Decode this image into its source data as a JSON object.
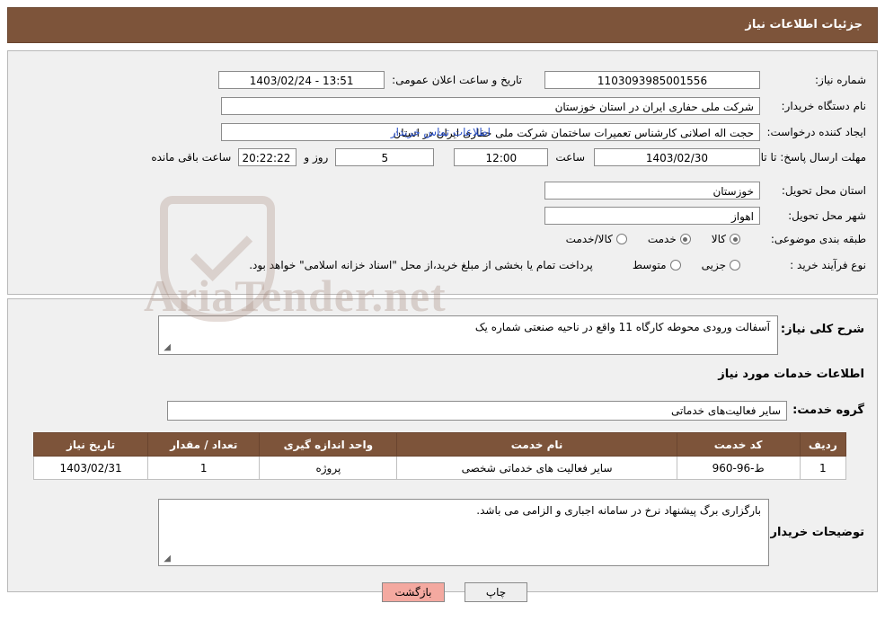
{
  "header": {
    "title": "جزئیات اطلاعات نیاز"
  },
  "form": {
    "need_number_label": "شماره نیاز:",
    "need_number_value": "1103093985001556",
    "announce_datetime_label": "تاریخ و ساعت اعلان عمومی:",
    "announce_datetime_value": "13:51 - 1403/02/24",
    "buyer_org_label": "نام دستگاه خریدار:",
    "buyer_org_value": "شرکت ملی حفاری ایران در استان خوزستان",
    "requester_label": "ایجاد کننده درخواست:",
    "requester_value": "حجت اله اصلانی کارشناس تعمیرات ساختمان شرکت ملی حفاری ایران در استان",
    "requester_link": "اطلاعات تماس خریدار",
    "deadline_label": "مهلت ارسال پاسخ: تا تاریخ:",
    "deadline_date": "1403/02/30",
    "time_label": "ساعت",
    "deadline_time": "12:00",
    "days_value": "5",
    "days_label": "روز و",
    "countdown_value": "20:22:22",
    "remaining_label": "ساعت باقی مانده",
    "province_label": "استان محل تحویل:",
    "province_value": "خوزستان",
    "city_label": "شهر محل تحویل:",
    "city_value": "اهواز",
    "category_label": "طبقه بندی موضوعی:",
    "category_options": [
      {
        "label": "کالا",
        "checked": true
      },
      {
        "label": "خدمت",
        "checked": true
      },
      {
        "label": "کالا/خدمت",
        "checked": false
      }
    ],
    "process_label": "نوع فرآیند خرید :",
    "process_options": [
      {
        "label": "جزیی",
        "checked": false
      },
      {
        "label": "متوسط",
        "checked": false
      }
    ],
    "payment_note": "پرداخت تمام یا بخشی از مبلغ خرید،از محل \"اسناد خزانه اسلامی\" خواهد بود."
  },
  "body": {
    "general_desc_label": "شرح کلی نیاز:",
    "general_desc_value": "آسفالت ورودی محوطه کارگاه 11 واقع در ناحیه صنعتی شماره یک",
    "services_section_title": "اطلاعات خدمات مورد نیاز",
    "service_group_label": "گروه خدمت:",
    "service_group_value": "سایر فعالیت‌های خدماتی",
    "buyer_notes_label": "توضیحات خریدار:",
    "buyer_notes_value": "بارگزاری برگ پیشنهاد نرخ در سامانه اجباری و الزامی می باشد."
  },
  "table": {
    "headers": [
      "ردیف",
      "کد خدمت",
      "نام خدمت",
      "واحد اندازه گیری",
      "تعداد / مقدار",
      "تاریخ نیاز"
    ],
    "rows": [
      {
        "row": "1",
        "code": "ط-96-960",
        "name": "سایر فعالیت های خدماتی شخصی",
        "unit": "پروژه",
        "qty": "1",
        "date": "1403/02/31"
      }
    ]
  },
  "footer": {
    "print_label": "چاپ",
    "back_label": "بازگشت"
  },
  "watermark": {
    "text": "AriaTender.net"
  }
}
